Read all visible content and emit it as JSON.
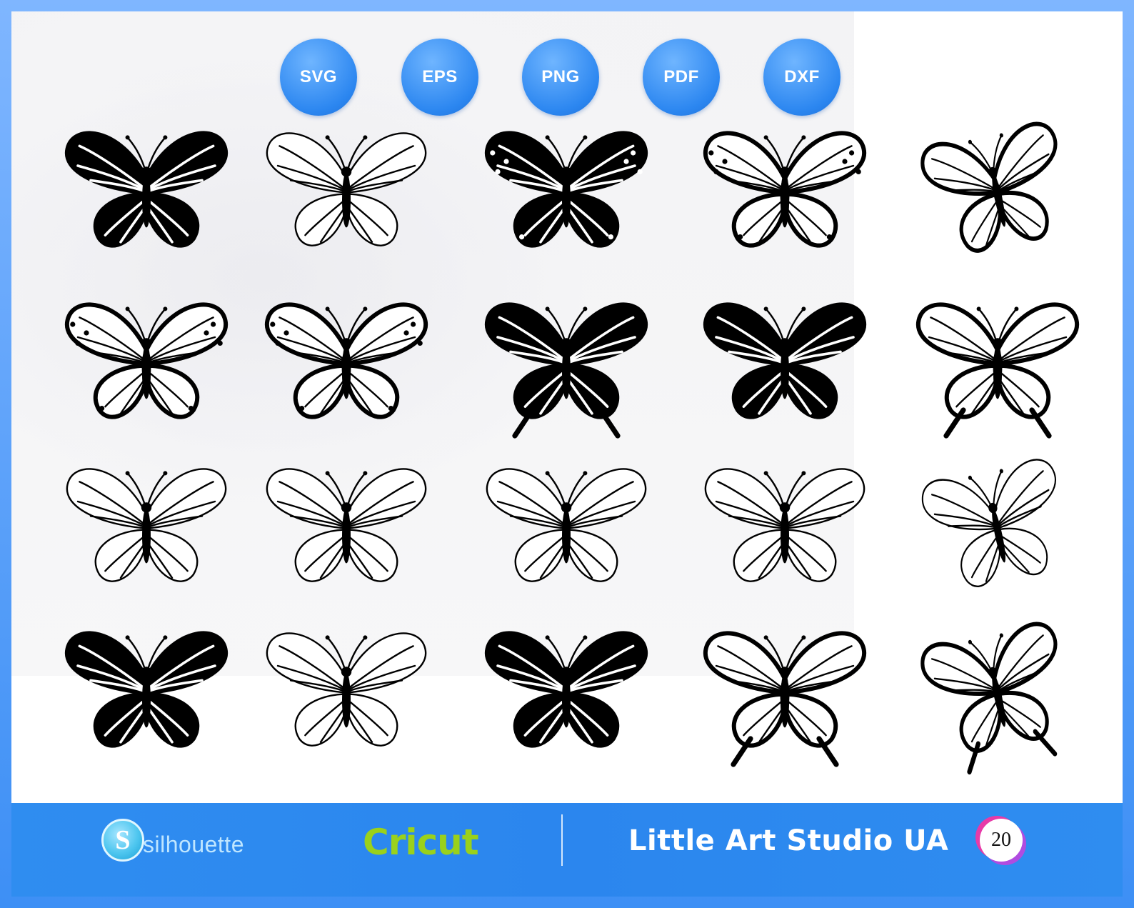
{
  "formats": [
    "SVG",
    "EPS",
    "PNG",
    "PDF",
    "DXF"
  ],
  "footer": {
    "silhouette_logo_letter": "S",
    "silhouette_label": "silhouette",
    "cricut_label": "Cricut",
    "studio_name": "Little Art Studio UA",
    "item_count": "20"
  },
  "colors": {
    "accent_blue": "#2b86f0",
    "cricut_green": "#9ad11b",
    "ink": "#000000"
  },
  "butterflies": [
    {
      "style": "solid-open-wings"
    },
    {
      "style": "outline-classic"
    },
    {
      "style": "solid-filled"
    },
    {
      "style": "monarch"
    },
    {
      "style": "side-profile"
    },
    {
      "style": "monarch-detailed"
    },
    {
      "style": "moth-wide"
    },
    {
      "style": "swallowtail-dark"
    },
    {
      "style": "tribal-swirl"
    },
    {
      "style": "swallowtail-light"
    },
    {
      "style": "outline-lace"
    },
    {
      "style": "outline-ornate"
    },
    {
      "style": "outline-simple"
    },
    {
      "style": "outline-fantasy"
    },
    {
      "style": "outline-side"
    },
    {
      "style": "tribal-open"
    },
    {
      "style": "outline-classic-2"
    },
    {
      "style": "solid-morpho"
    },
    {
      "style": "swallowtail-wide"
    },
    {
      "style": "swallowtail-side"
    }
  ]
}
